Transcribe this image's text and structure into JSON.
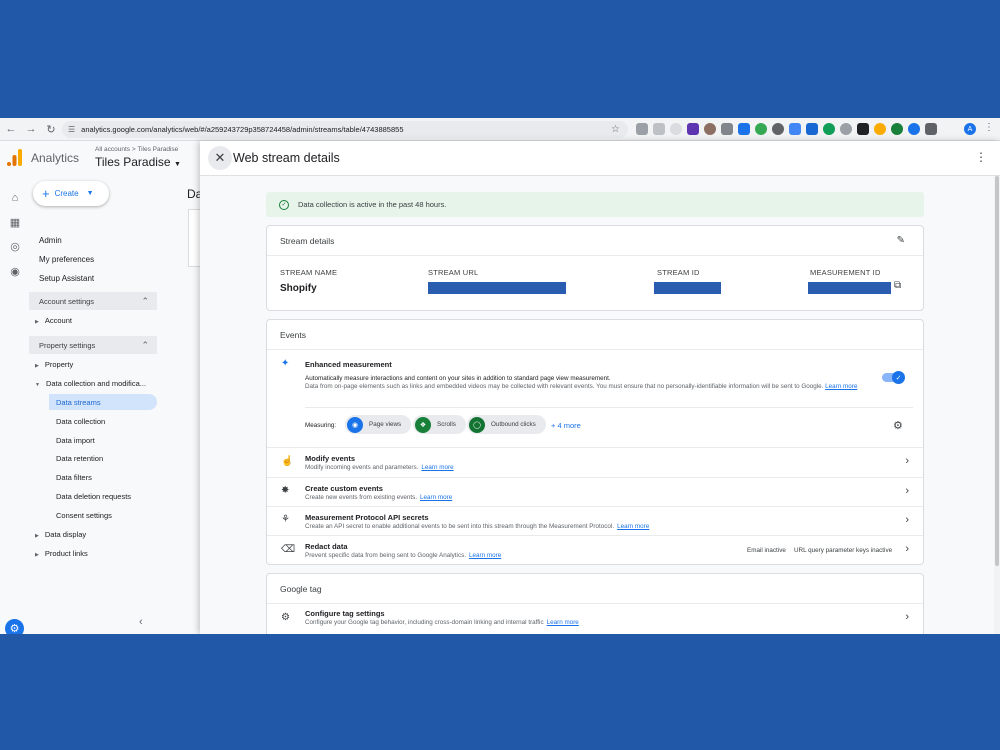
{
  "browser": {
    "url": "analytics.google.com/analytics/web/#/a259243729p358724458/admin/streams/table/4743885855",
    "profile_initial": "A"
  },
  "ga": {
    "app_name": "Analytics",
    "breadcrumb": "All accounts > Tiles Paradise",
    "property_name": "Tiles Paradise",
    "create_label": "Create",
    "nav": {
      "admin": "Admin",
      "my_preferences": "My preferences",
      "setup_assistant": "Setup Assistant",
      "account_settings": "Account settings",
      "account": "Account",
      "property_settings": "Property settings",
      "property": "Property",
      "data_collection_group": "Data collection and modifica...",
      "data_streams": "Data streams",
      "data_collection": "Data collection",
      "data_import": "Data import",
      "data_retention": "Data retention",
      "data_filters": "Data filters",
      "data_deletion": "Data deletion requests",
      "consent_settings": "Consent settings",
      "data_display": "Data display",
      "product_links": "Product links"
    },
    "page_fragment": "Da",
    "accent": "#1a73e8"
  },
  "panel": {
    "title": "Web stream details",
    "status_text": "Data collection is active in the past 48 hours.",
    "stream_details": {
      "heading": "Stream details",
      "name_label": "STREAM NAME",
      "name_value": "Shopify",
      "url_label": "STREAM URL",
      "id_label": "STREAM ID",
      "measurement_label": "MEASUREMENT ID"
    },
    "events": {
      "heading": "Events",
      "enhanced": {
        "title": "Enhanced measurement",
        "desc1": "Automatically measure interactions and content on your sites in addition to standard page view measurement.",
        "desc2": "Data from on-page elements such as links and embedded videos may be collected with relevant events. You must ensure that no personally-identifiable information will be sent to Google.",
        "learn_more": "Learn more",
        "measuring_label": "Measuring:",
        "chips": [
          "Page views",
          "Scrolls",
          "Outbound clicks"
        ],
        "more_link": "+ 4 more",
        "enabled": true
      },
      "modify": {
        "title": "Modify events",
        "desc": "Modify incoming events and parameters.",
        "learn_more": "Learn more"
      },
      "custom": {
        "title": "Create custom events",
        "desc": "Create new events from existing events.",
        "learn_more": "Learn more"
      },
      "mp": {
        "title": "Measurement Protocol API secrets",
        "desc": "Create an API secret to enable additional events to be sent into this stream through the Measurement Protocol.",
        "learn_more": "Learn more"
      },
      "redact": {
        "title": "Redact data",
        "desc": "Prevent specific data from being sent to Google Analytics.",
        "learn_more": "Learn more",
        "email_status": "Email inactive",
        "url_status": "URL query parameter keys inactive"
      }
    },
    "google_tag": {
      "heading": "Google tag",
      "configure": {
        "title": "Configure tag settings",
        "desc": "Configure your Google tag behavior, including cross-domain linking and internal traffic",
        "learn_more": "Learn more"
      }
    }
  }
}
